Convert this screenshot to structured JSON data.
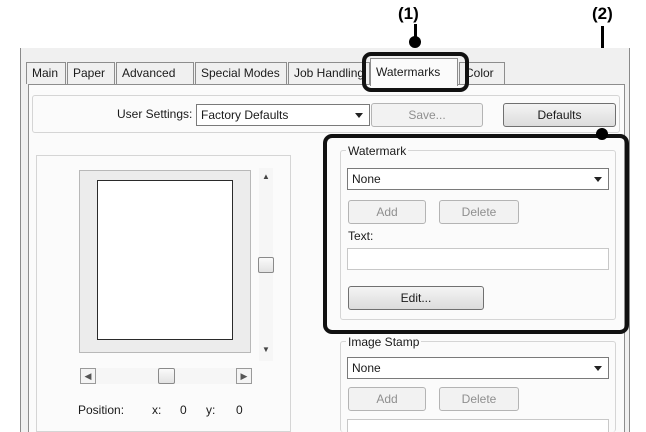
{
  "callouts": [
    "(1)",
    "(2)"
  ],
  "tabs": [
    {
      "label": "Main"
    },
    {
      "label": "Paper"
    },
    {
      "label": "Advanced"
    },
    {
      "label": "Special Modes"
    },
    {
      "label": "Job Handling"
    },
    {
      "label": "Watermarks",
      "active": true
    },
    {
      "label": "Color"
    }
  ],
  "user_settings": {
    "label": "User Settings:",
    "value": "Factory Defaults",
    "save_label": "Save...",
    "defaults_label": "Defaults"
  },
  "preview": {
    "position_label": "Position:",
    "x_label": "x:",
    "x_value": "0",
    "y_label": "y:",
    "y_value": "0"
  },
  "watermark": {
    "group_label": "Watermark",
    "value": "None",
    "add_label": "Add",
    "delete_label": "Delete",
    "text_label": "Text:",
    "text_value": "",
    "edit_label": "Edit..."
  },
  "image_stamp": {
    "group_label": "Image Stamp",
    "value": "None",
    "add_label": "Add",
    "delete_label": "Delete"
  },
  "colors": {
    "dialog_bg": "#f0f0f0",
    "panel_bg": "#fbfbfb",
    "highlight": "#111111",
    "disabled_text": "#8f8f8f"
  }
}
